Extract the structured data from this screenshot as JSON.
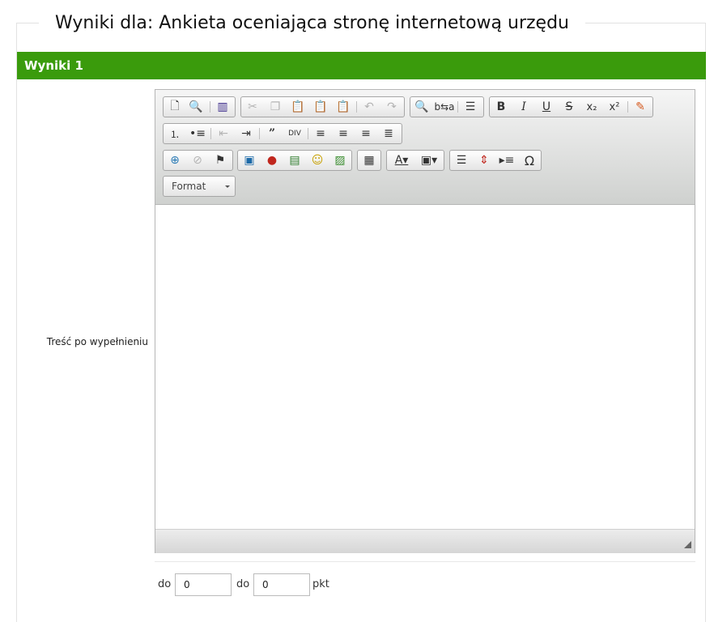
{
  "page": {
    "title": "Wyniki dla: Ankieta oceniająca stronę internetową urzędu"
  },
  "section": {
    "title": "Wyniki 1"
  },
  "field": {
    "label": "Treść po wypełnieniu"
  },
  "editor": {
    "format_label": "Format",
    "toolbar_rows": [
      [
        [
          "new-page-icon",
          "preview-icon",
          "templates-icon"
        ],
        [
          "cut-icon",
          "copy-icon",
          "paste-icon",
          "paste-text-icon",
          "paste-word-icon",
          "undo-icon",
          "redo-icon"
        ],
        [
          "find-icon",
          "replace-icon",
          "select-all-icon"
        ],
        [
          "bold-icon",
          "italic-icon",
          "underline-icon",
          "strikethrough-icon",
          "subscript-icon",
          "superscript-icon",
          "remove-format-icon"
        ]
      ],
      [
        [
          "numbered-list-icon",
          "bulleted-list-icon",
          "outdent-icon",
          "indent-icon",
          "blockquote-icon",
          "create-div-icon",
          "align-left-icon",
          "align-center-icon",
          "align-right-icon",
          "justify-icon"
        ]
      ],
      [
        [
          "link-icon",
          "unlink-icon",
          "anchor-icon"
        ],
        [
          "image-icon",
          "flash-icon",
          "media-icon",
          "smiley-icon",
          "gallery-icon"
        ],
        [
          "table-icon"
        ],
        [
          "text-color-icon",
          "background-color-icon"
        ],
        [
          "horizontal-line-icon",
          "page-break-icon",
          "show-blocks-icon",
          "special-char-icon"
        ]
      ]
    ]
  },
  "score": {
    "from_label": "do",
    "to_label": "do",
    "from_value": "0",
    "to_value": "0",
    "unit": "pkt"
  },
  "colors": {
    "accent": "#3a9b0c"
  }
}
